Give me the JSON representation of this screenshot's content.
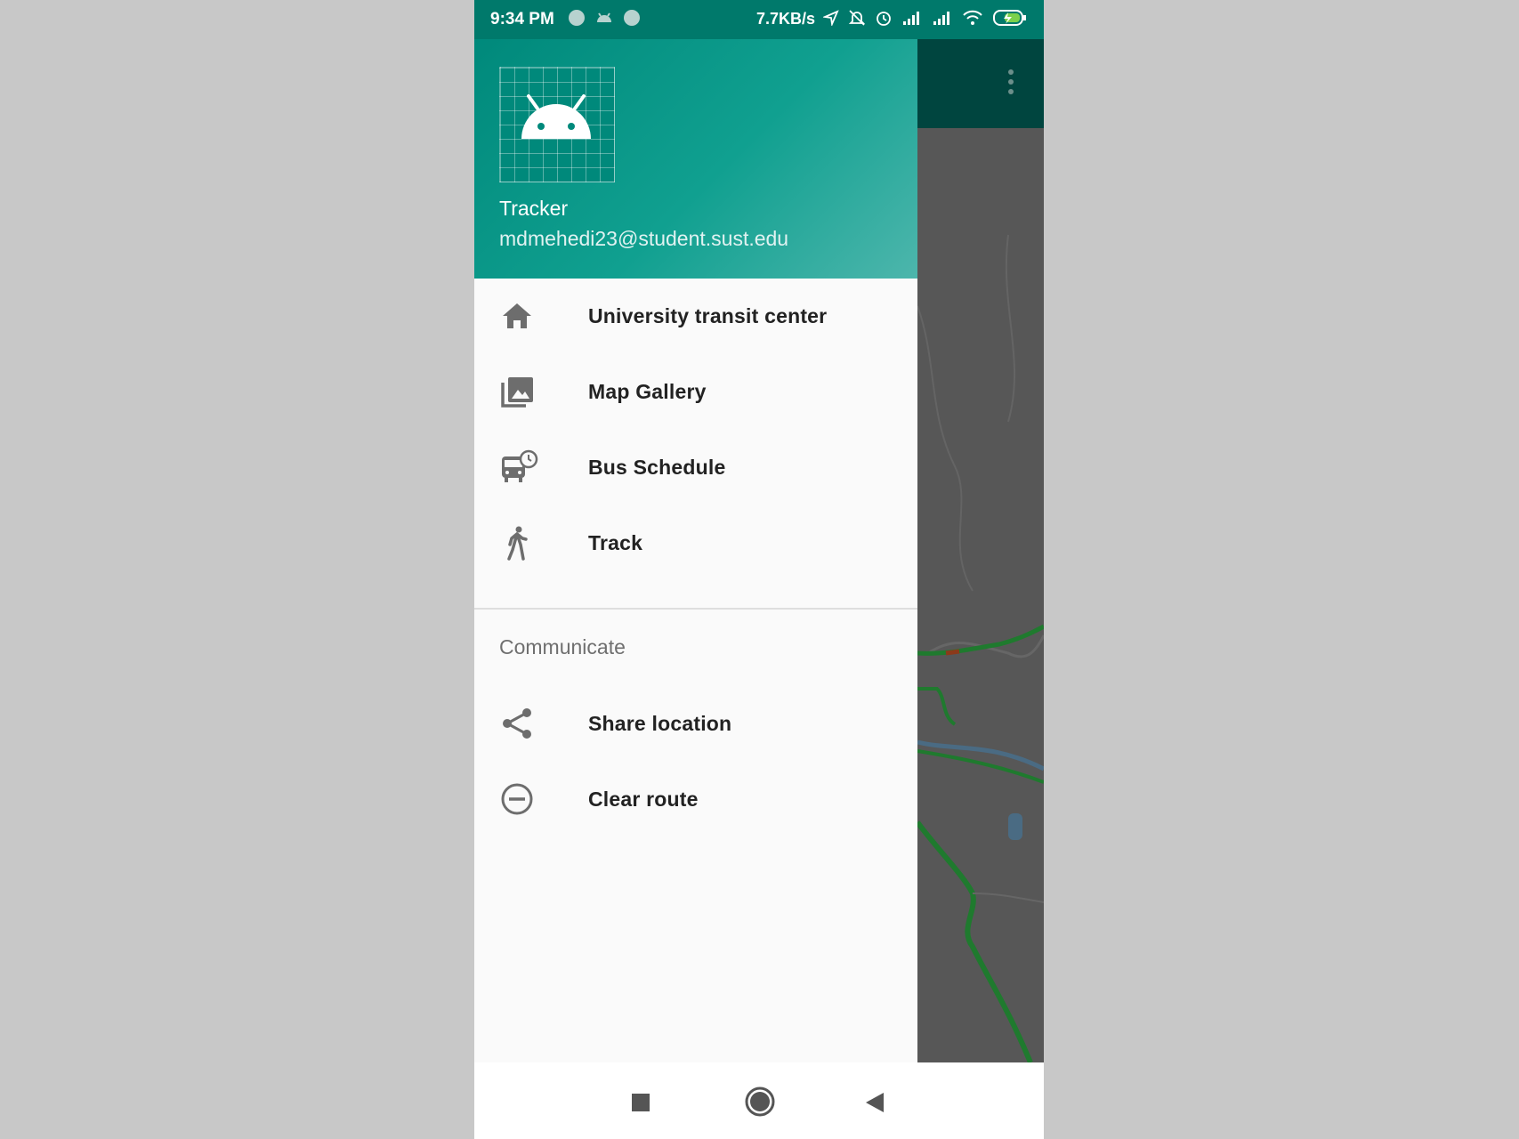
{
  "status_bar": {
    "time": "9:34 PM",
    "network_speed": "7.7KB/s",
    "icons": [
      "notification-dot-icon",
      "android-icon",
      "notification-dot-icon",
      "location-arrow-icon",
      "notifications-off-icon",
      "alarm-icon",
      "signal-icon",
      "signal-icon",
      "wifi-icon",
      "battery-charging-icon"
    ]
  },
  "drawer": {
    "header": {
      "app_name": "Tracker",
      "email": "mdmehedi23@student.sust.edu"
    },
    "items": [
      {
        "label": "University transit center",
        "icon": "home-icon"
      },
      {
        "label": "Map Gallery",
        "icon": "photo-library-icon"
      },
      {
        "label": "Bus Schedule",
        "icon": "bus-schedule-icon"
      },
      {
        "label": "Track",
        "icon": "walk-icon"
      }
    ],
    "section_header": "Communicate",
    "communicate_items": [
      {
        "label": "Share location",
        "icon": "share-icon"
      },
      {
        "label": "Clear route",
        "icon": "remove-circle-icon"
      }
    ]
  },
  "colors": {
    "primary": "#00897b",
    "primary_dark": "#00796b",
    "scrim_appbar": "#00453f",
    "icon_gray": "#6d6d6d",
    "traffic_green": "#1f7a2e"
  },
  "navigation_bar": [
    "recents-square-icon",
    "home-circle-icon",
    "back-triangle-icon"
  ]
}
